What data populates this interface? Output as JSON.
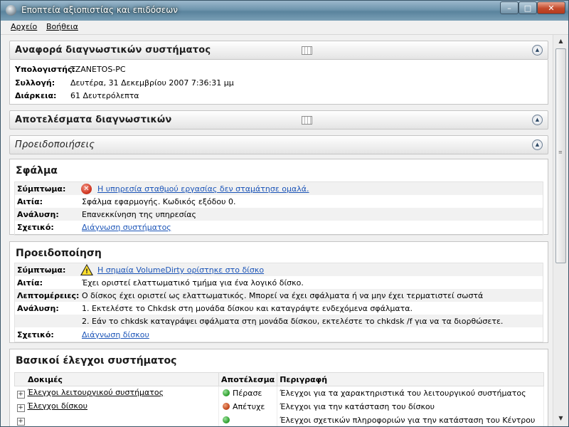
{
  "window": {
    "title": "Εποπτεία αξιοπιστίας και επιδόσεων",
    "controls": {
      "minimize": "–",
      "maximize": "□",
      "close": "✕"
    }
  },
  "menu": {
    "items": [
      "Αρχείο",
      "Βοήθεια"
    ]
  },
  "report_header": {
    "title": "Αναφορά διαγνωστικών συστήματος",
    "rows": [
      {
        "label": "Υπολογιστής:",
        "value": "TZANETOS-PC"
      },
      {
        "label": "Συλλογή:",
        "value": "Δευτέρα, 31 Δεκεμβρίου 2007 7:36:31 μμ"
      },
      {
        "label": "Διάρκεια:",
        "value": "61 Δευτερόλεπτα"
      }
    ]
  },
  "results_header": {
    "title": "Αποτελέσματα διαγνωστικών"
  },
  "warnings_header": {
    "title": "Προειδοποιήσεις"
  },
  "error_panel": {
    "title": "Σφάλμα",
    "symptom_label": "Σύμπτωμα:",
    "symptom": "Η υπηρεσία σταθμού εργασίας δεν σταμάτησε ομαλά.",
    "cause_label": "Αιτία:",
    "cause": "Σφάλμα εφαρμογής. Κωδικός εξόδου 0.",
    "analysis_label": "Ανάλυση:",
    "analysis": "Επανεκκίνηση της υπηρεσίας",
    "related_label": "Σχετικό:",
    "related": "Διάγνωση συστήματος"
  },
  "warning_panel": {
    "title": "Προειδοποίηση",
    "symptom_label": "Σύμπτωμα:",
    "symptom": "Η σημαία VolumeDirty ορίστηκε στο δίσκο",
    "cause_label": "Αιτία:",
    "cause": "Έχει οριστεί ελαττωματικό τμήμα για ένα λογικό δίσκο.",
    "details_label": "Λεπτομέρειες:",
    "details": "Ο δίσκος έχει οριστεί ως ελαττωματικός. Μπορεί να έχει σφάλματα ή να μην έχει τερματιστεί σωστά",
    "analysis_label": "Ανάλυση:",
    "analysis_1": "1. Εκτελέστε το Chkdsk στη μονάδα δίσκου και καταγράψτε ενδεχόμενα σφάλματα.",
    "analysis_2": "2. Εάν το chkdsk καταγράψει σφάλματα στη μονάδα δίσκου, εκτελέστε το chkdsk /f για να τα διορθώσετε.",
    "related_label": "Σχετικό:",
    "related": "Διάγνωση δίσκου"
  },
  "basic_checks": {
    "title": "Βασικοί έλεγχοι συστήματος",
    "columns": [
      "Δοκιμές",
      "Αποτέλεσμα",
      "Περιγραφή"
    ],
    "rows": [
      {
        "expander": "+",
        "test": "Έλεγχοι λειτουργικού συστήματος",
        "status_color": "#2e9e2e",
        "result": "Πέρασε",
        "description": "Έλεγχοι για τα χαρακτηριστικά του λειτουργικού συστήματος"
      },
      {
        "expander": "+",
        "test": "Έλεγχοι δίσκου",
        "status_color": "#c0451b",
        "result": "Απέτυχε",
        "description": "Έλεγχοι για την κατάσταση του δίσκου"
      },
      {
        "expander": "+",
        "test": "",
        "status_color": "#2e9e2e",
        "result": "",
        "description": "Έλεγχοι σχετικών πληροφοριών για την κατάσταση του Κέντρου"
      }
    ]
  },
  "scrollbar": {
    "up": "▲",
    "down": "▼",
    "grip": "≡"
  },
  "icons": {
    "collapse": "▲",
    "error_glyph": "✕",
    "warning_glyph": "!"
  }
}
